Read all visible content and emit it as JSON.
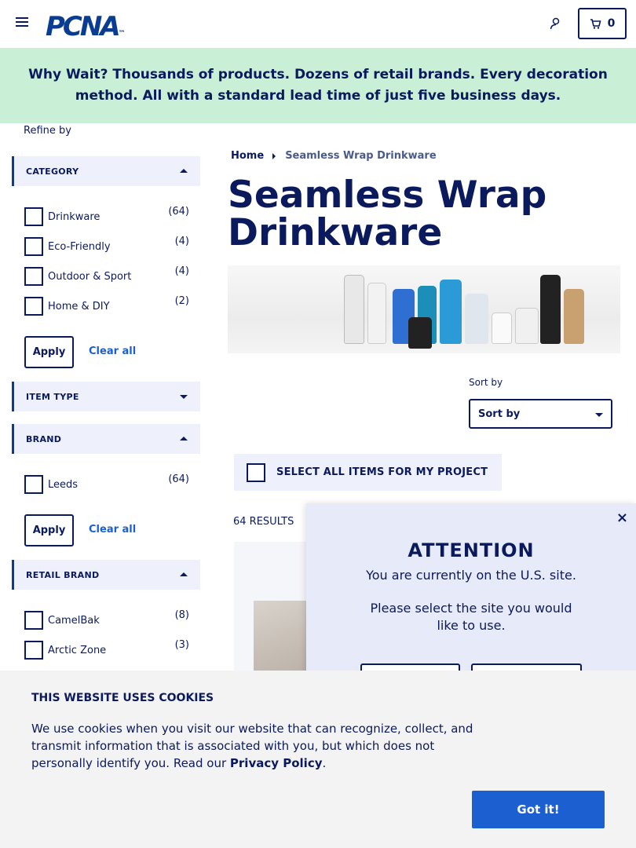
{
  "header": {
    "logo_text": "PCNA",
    "logo_suffix": "™",
    "cart_count": "0"
  },
  "banner": {
    "lead": "Why Wait?",
    "text": " Thousands of products. Dozens of retail brands. Every decoration method. All with a standard lead time of just five business days."
  },
  "sidebar": {
    "refine_label": "Refine by",
    "category": {
      "title": "CATEGORY",
      "options": [
        {
          "label": "Drinkware",
          "count": "(64)"
        },
        {
          "label": "Eco-Friendly",
          "count": "(4)"
        },
        {
          "label": "Outdoor & Sport",
          "count": "(4)"
        },
        {
          "label": "Home & DIY",
          "count": "(2)"
        }
      ],
      "apply": "Apply",
      "clear": "Clear all"
    },
    "item_type": {
      "title": "ITEM TYPE"
    },
    "brand": {
      "title": "BRAND",
      "options": [
        {
          "label": "Leeds",
          "count": "(64)"
        }
      ],
      "apply": "Apply",
      "clear": "Clear all"
    },
    "retail_brand": {
      "title": "RETAIL BRAND",
      "options": [
        {
          "label": "CamelBak",
          "count": "(8)"
        },
        {
          "label": "Arctic Zone",
          "count": "(3)"
        }
      ]
    }
  },
  "main": {
    "breadcrumb": {
      "home": "Home",
      "current": "Seamless Wrap Drinkware"
    },
    "title": "Seamless Wrap Drinkware",
    "sort_label": "Sort by",
    "sort_value": "Sort by",
    "select_all": "SELECT ALL ITEMS FOR MY PROJECT",
    "results": "64 RESULTS"
  },
  "modal": {
    "close": "×",
    "heading": "ATTENTION",
    "line1": "You are currently on the U.S. site.",
    "line2": "Please select the site you would like to use."
  },
  "cookie": {
    "title": "THIS WEBSITE USES COOKIES",
    "text": "We use cookies when you visit our website that can recognize, collect, and transmit information that is associated with you, but which does not personally identify you. Read our ",
    "link": "Privacy Policy",
    "end": ".",
    "button": "Got it!"
  },
  "colors": {
    "navy": "#0b1a5c",
    "brand_blue": "#0a3d91",
    "banner_green": "#c9f0d6",
    "link_blue": "#1b5fd1"
  }
}
